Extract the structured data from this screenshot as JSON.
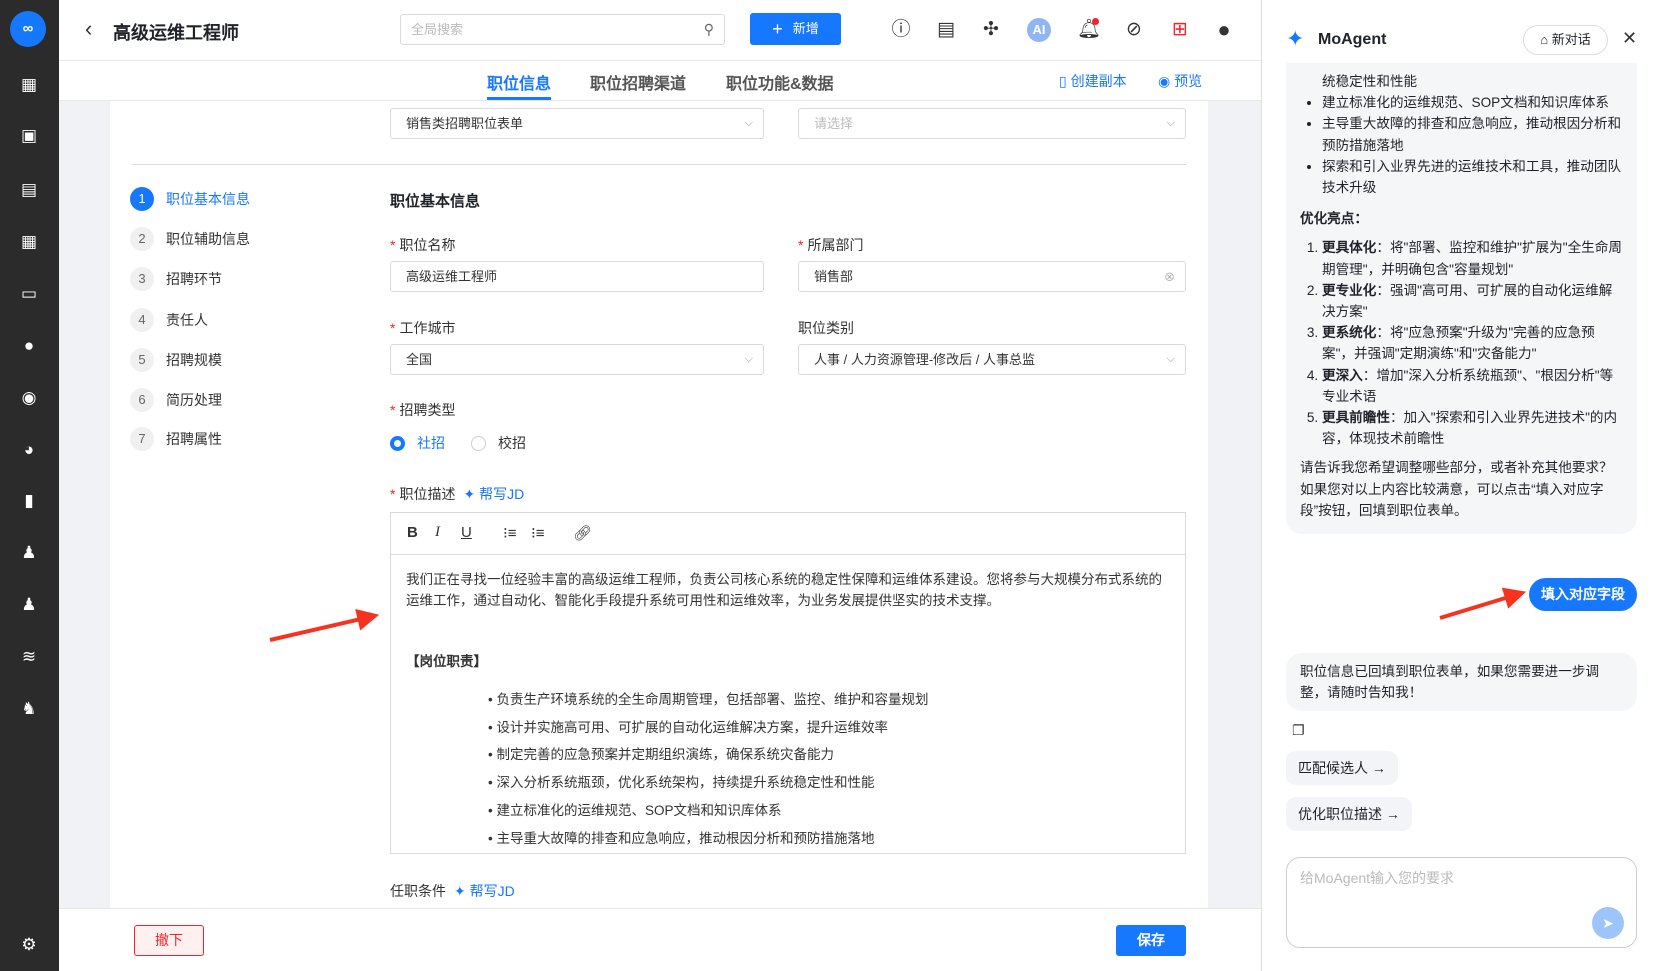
{
  "sidebar": {
    "logo": "∞",
    "icons": [
      "dashboard-icon",
      "briefcase-icon",
      "resume-icon",
      "calendar-icon",
      "id-card-icon",
      "wechat-icon",
      "thumbs-up-icon",
      "pie-chart-icon",
      "bar-chart-icon",
      "users-icon",
      "user-add-icon",
      "layers-icon",
      "team-icon",
      "settings-icon"
    ]
  },
  "header": {
    "title": "高级运维工程师",
    "search_placeholder": "全局搜索",
    "new_button": "新增",
    "ai_label": "AI"
  },
  "tabs": [
    {
      "label": "职位信息",
      "active": true
    },
    {
      "label": "职位招聘渠道"
    },
    {
      "label": "职位功能&数据"
    }
  ],
  "actions": {
    "copy": "创建副本",
    "preview": "预览"
  },
  "top_selects": [
    {
      "value": "销售类招聘职位表单"
    },
    {
      "placeholder": "请选择"
    }
  ],
  "steps": [
    {
      "n": "1",
      "label": "职位基本信息"
    },
    {
      "n": "2",
      "label": "职位辅助信息"
    },
    {
      "n": "3",
      "label": "招聘环节"
    },
    {
      "n": "4",
      "label": "责任人"
    },
    {
      "n": "5",
      "label": "招聘规模"
    },
    {
      "n": "6",
      "label": "简历处理"
    },
    {
      "n": "7",
      "label": "招聘属性"
    }
  ],
  "form": {
    "section_title": "职位基本信息",
    "job_name_label": "职位名称",
    "job_name": "高级运维工程师",
    "dept_label": "所属部门",
    "dept": "销售部",
    "city_label": "工作城市",
    "city": "全国",
    "category_label": "职位类别",
    "category": "人事 / 人力资源管理-修改后 / 人事总监",
    "type_label": "招聘类型",
    "type_options": [
      "社招",
      "校招"
    ],
    "desc_label": "职位描述",
    "help_jd": "帮写JD",
    "desc_intro": "我们正在寻找一位经验丰富的高级运维工程师，负责公司核心系统的稳定性保障和运维体系建设。您将参与大规模分布式系统的运维工作，通过自动化、智能化手段提升系统可用性和运维效率，为业务发展提供坚实的技术支撑。",
    "duty_title": "【岗位职责】",
    "duties": [
      "• 负责生产环境系统的全生命周期管理，包括部署、监控、维护和容量规划",
      "• 设计并实施高可用、可扩展的自动化运维解决方案，提升运维效率",
      "• 制定完善的应急预案并定期组织演练，确保系统灾备能力",
      "• 深入分析系统瓶颈，优化系统架构，持续提升系统稳定性和性能",
      "• 建立标准化的运维规范、SOP文档和知识库体系",
      "• 主导重大故障的排查和应急响应，推动根因分析和预防措施落地"
    ],
    "req_label": "任职条件"
  },
  "footer": {
    "withdraw": "撤下",
    "save": "保存"
  },
  "agent": {
    "title": "MoAgent",
    "new_chat": "新对话",
    "list_top": [
      "统稳定性和性能",
      "建立标准化的运维规范、SOP文档和知识库体系",
      "主导重大故障的排查和应急响应，推动根因分析和预防措施落地",
      "探索和引入业界先进的运维技术和工具，推动团队技术升级"
    ],
    "highlights_title": "优化亮点：",
    "highlights": [
      {
        "b": "更具体化",
        "t": "：将\"部署、监控和维护\"扩展为\"全生命周期管理\"，并明确包含\"容量规划\""
      },
      {
        "b": "更专业化",
        "t": "：强调\"高可用、可扩展的自动化运维解决方案\""
      },
      {
        "b": "更系统化",
        "t": "：将\"应急预案\"升级为\"完善的应急预案\"，并强调\"定期演练\"和\"灾备能力\""
      },
      {
        "b": "更深入",
        "t": "：增加\"深入分析系统瓶颈\"、\"根因分析\"等专业术语"
      },
      {
        "b": "更具前瞻性",
        "t": "：加入\"探索和引入业界先进技术\"的内容，体现技术前瞻性"
      }
    ],
    "closing": "请告诉我您希望调整哪些部分，或者补充其他要求？如果您对以上内容比较满意，可以点击“填入对应字段”按钮，回填到职位表单。",
    "fill_button": "填入对应字段",
    "reply": "职位信息已回填到职位表单，如果您需要进一步调整，请随时告知我！",
    "chips": [
      "匹配候选人",
      "优化职位描述"
    ],
    "input_placeholder": "给MoAgent输入您的要求"
  },
  "colors": {
    "primary": "#1677ff",
    "annotation": "#f5331f",
    "sidebar": "#2b2b2b"
  }
}
